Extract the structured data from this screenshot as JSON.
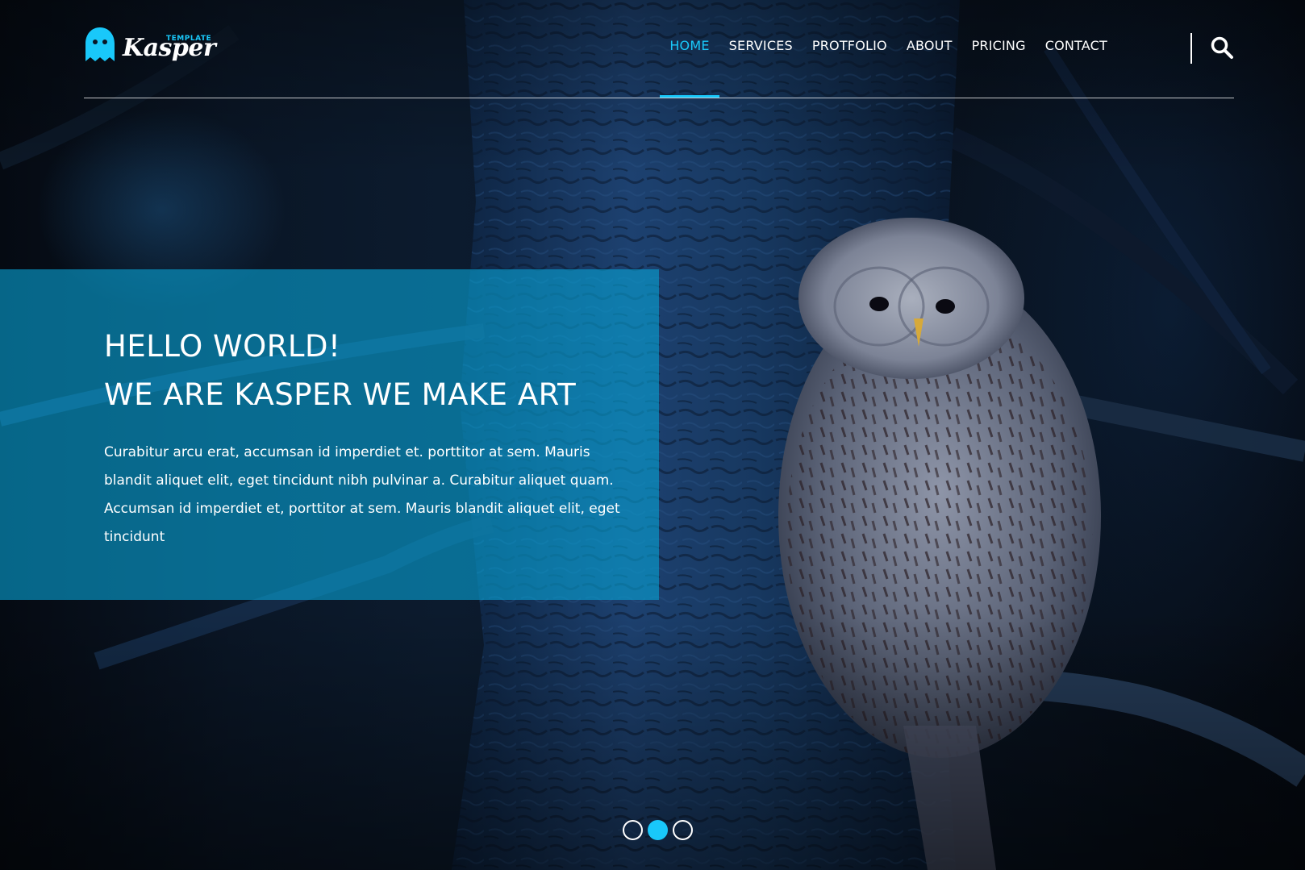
{
  "brand": {
    "name": "Kasper",
    "tagline": "TEMPLATE",
    "accent_color": "#19c8fa"
  },
  "nav": {
    "items": [
      {
        "label": "HOME",
        "active": true
      },
      {
        "label": "SERVICES",
        "active": false
      },
      {
        "label": "PROTFOLIO",
        "active": false
      },
      {
        "label": "ABOUT",
        "active": false
      },
      {
        "label": "PRICING",
        "active": false
      },
      {
        "label": "CONTACT",
        "active": false
      }
    ],
    "search_icon": "search-icon"
  },
  "hero": {
    "title_line1": "HELLO WORLD!",
    "title_line2": "WE ARE KASPER WE MAKE ART",
    "text": "Curabitur arcu erat, accumsan id imperdiet et. porttitor at sem. Mauris blandit aliquet elit, eget tincidunt nibh pulvinar a. Curabitur aliquet quam. Accumsan id imperdiet et, porttitor at sem. Mauris blandit aliquet elit, eget tincidunt",
    "box_color": "#08a0d2"
  },
  "slider": {
    "slide_count": 3,
    "active_index": 1
  }
}
